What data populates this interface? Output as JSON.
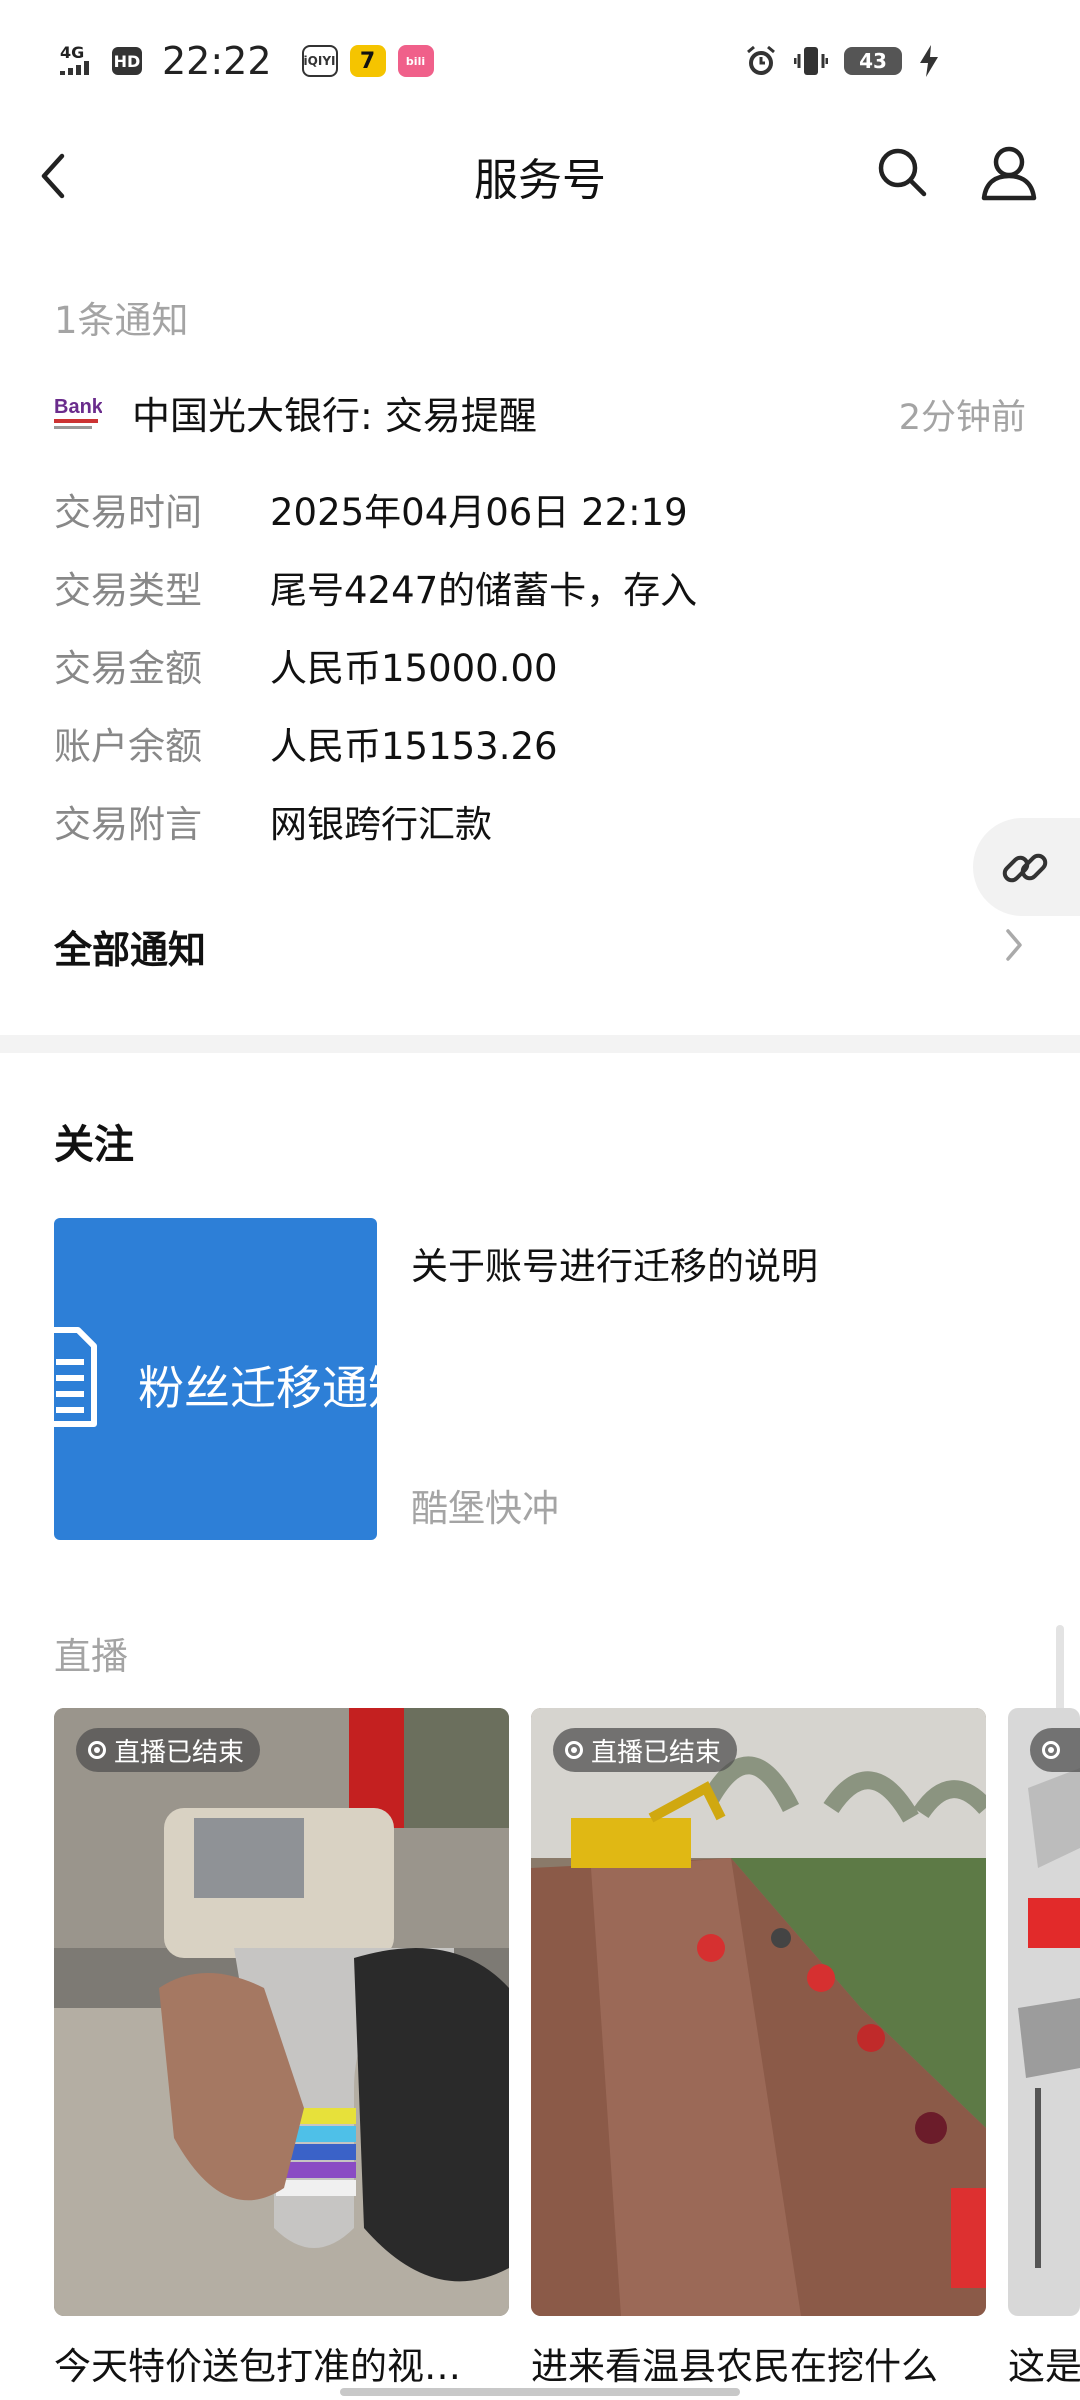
{
  "status_bar": {
    "network": "4G",
    "hd": "HD",
    "time": "22:22",
    "apps": [
      "iQIYI",
      "7",
      "bili"
    ],
    "battery": "43",
    "icons": [
      "alarm-icon",
      "vibrate-icon",
      "charging-icon"
    ]
  },
  "header": {
    "title": "服务号",
    "icons": [
      "back-arrow-icon",
      "search-icon",
      "user-icon"
    ]
  },
  "notifications": {
    "count_label": "1条通知",
    "item": {
      "bank_logo_text": "Bank",
      "title": "中国光大银行: 交易提醒",
      "time": "2分钟前",
      "details": [
        {
          "label": "交易时间",
          "value": "2025年04月06日 22:19"
        },
        {
          "label": "交易类型",
          "value": "尾号4247的储蓄卡，存入"
        },
        {
          "label": "交易金额",
          "value": "人民币15000.00"
        },
        {
          "label": "账户余额",
          "value": "人民币15153.26"
        },
        {
          "label": "交易附言",
          "value": "网银跨行汇款"
        }
      ]
    },
    "all_label": "全部通知"
  },
  "follow": {
    "heading": "关注",
    "article": {
      "thumbnail_text": "粉丝迁移通知",
      "title": "关于账号进行迁移的说明",
      "source": "酷堡快冲"
    }
  },
  "live": {
    "heading": "直播",
    "badge": "直播已结束",
    "cards": [
      {
        "title": "今天特价送包打准的视…"
      },
      {
        "title": "进来看温县农民在挖什么"
      },
      {
        "title": "这是"
      }
    ]
  },
  "colors": {
    "accent_blue": "#2d7fd7",
    "muted_text": "#a4a4a4",
    "label_text": "#888888"
  }
}
